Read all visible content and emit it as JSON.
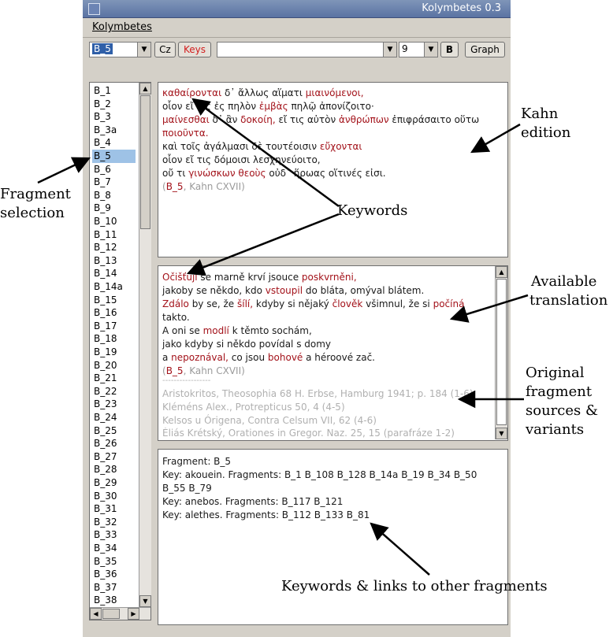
{
  "window": {
    "title": "Kolymbetes 0.3"
  },
  "menu": {
    "kolymbetes": "Kolymbetes"
  },
  "toolbar": {
    "fragment_select": "B_5",
    "cz_label": "Cz",
    "keys_label": "Keys",
    "search_value": "",
    "size_value": "9",
    "bold_label": "B",
    "graph_label": "Graph"
  },
  "fragments": [
    "B_1",
    "B_2",
    "B_3",
    "B_3a",
    "B_4",
    "B_5",
    "B_6",
    "B_7",
    "B_8",
    "B_9",
    "B_10",
    "B_11",
    "B_12",
    "B_13",
    "B_14",
    "B_14a",
    "B_15",
    "B_16",
    "B_17",
    "B_18",
    "B_19",
    "B_20",
    "B_21",
    "B_22",
    "B_23",
    "B_24",
    "B_25",
    "B_26",
    "B_27",
    "B_28",
    "B_29",
    "B_30",
    "B_31",
    "B_32",
    "B_33",
    "B_34",
    "B_35",
    "B_36",
    "B_37",
    "B_38"
  ],
  "selected_fragment": "B_5",
  "greek": {
    "l1a": "καθαίρονται",
    "l1b": " δ᾽ ἄλλως αἵματι ",
    "l1c": "μιαινόμενοι,",
    "l2a": "οἷον εἴ τις ἐς πηλὸν ",
    "l2b": "ἐμβὰς",
    "l2c": " πηλῷ ἀπονίζοιτο·",
    "l3a": "μαίνεσθαι",
    "l3b": " δ᾽ ἂν ",
    "l3c": "δοκοίη,",
    "l3d": " εἴ τις αὐτὸν ",
    "l3e": "ἀνθρώπων",
    "l3f": " ἐπιφράσαιτο οὕτω",
    "l4": "ποιοῦντα.",
    "l5a": "καὶ τοῖς ἀγάλμασι δὲ τουτέοισιν ",
    "l5b": "εὔχονται",
    "l6": "οἷον εἴ τις δόμοισι λεσχηνεύοιτο,",
    "l7a": "οὔ τι ",
    "l7b": "γινώσκων",
    "l7c": " ",
    "l7d": "θεοὺς",
    "l7e": " οὐδ᾽ ἥρωας οἵτινές εἰσι.",
    "ref_open": "(",
    "ref_frag": "B_5",
    "ref_rest": ", Kahn CXVII)"
  },
  "czech": {
    "l1a": "Očišťují",
    "l1b": " se marně krví jsouce ",
    "l1c": "poskvrněni,",
    "l2a": "jakoby se někdo, kdo ",
    "l2b": "vstoupil",
    "l2c": " do bláta, omýval blátem.",
    "l3a": "Zdálo",
    "l3b": " by se, že ",
    "l3c": "šílí,",
    "l3d": " kdyby si nějaký ",
    "l3e": "člověk",
    "l3f": " všimnul, že si ",
    "l3g": "počíná",
    "l4": "takto.",
    "l5a": "A oni se ",
    "l5b": "modlí",
    "l5c": " k těmto sochám,",
    "l6": "jako kdyby si někdo povídal s domy",
    "l7a": "a ",
    "l7b": "nepoznával,",
    "l7c": " co jsou ",
    "l7d": "bohové",
    "l7e": " a héroové zač.",
    "ref_open": "(",
    "ref_frag": "B_5",
    "ref_rest": ", Kahn CXVII)",
    "separator": "-----------------",
    "src1": "Aristokritos, Theosophia 68 H. Erbse, Hamburg 1941; p. 184  (1-6)",
    "src2": "Kléméns Alex., Protrepticus 50, 4  (4-5)",
    "src3": "Kelsos u Órigena, Contra Celsum VII, 62  (4-6)",
    "src4": "Éliás Krétský, Orationes in Gregor. Naz. 25, 15  (parafráze 1-2)"
  },
  "keys": {
    "l1": "Fragment: B_5",
    "l2": "Key: akouein. Fragments: B_1 B_108 B_128 B_14a B_19 B_34 B_50",
    "l3": "B_55 B_79",
    "l4": "Key: anebos. Fragments: B_117 B_121",
    "l5": "Key: alethes. Fragments: B_112 B_133 B_81"
  },
  "annotations": {
    "kahn1": "Kahn",
    "kahn2": "edition",
    "frag1": "Fragment",
    "frag2": "selection",
    "keywords": "Keywords",
    "avail1": "Available",
    "avail2": "translation",
    "orig1": "Original",
    "orig2": "fragment",
    "orig3": "sources &",
    "orig4": "variants",
    "links": "Keywords & links to other fragments"
  },
  "colors": {
    "keyword": "#a3121a",
    "reference": "#9a9a9a",
    "selection": "#9ec2e6"
  }
}
